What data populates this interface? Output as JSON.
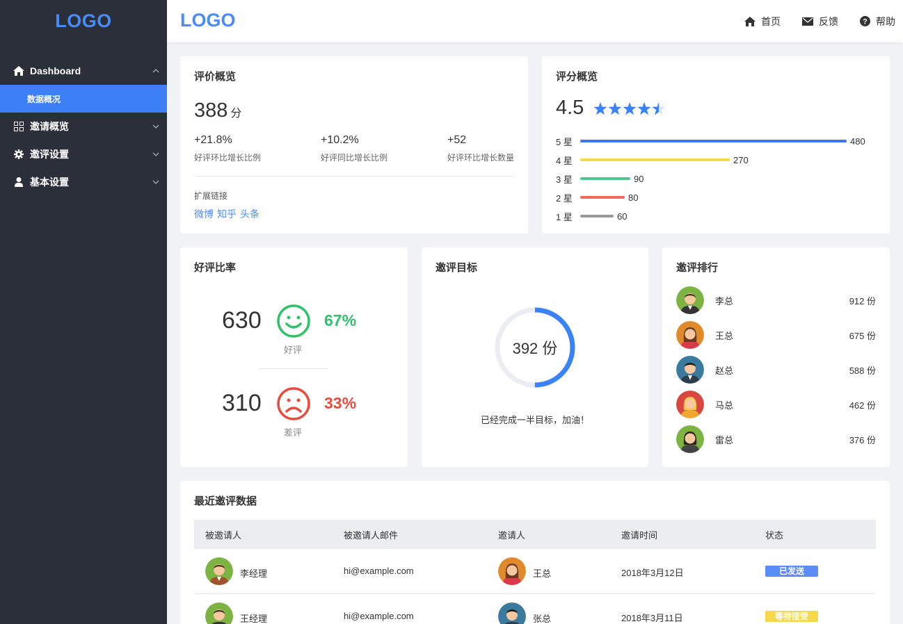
{
  "sidebar": {
    "logo": "LOGO",
    "menu": [
      {
        "label": "Dashboard",
        "icon": "home-icon",
        "expanded": true
      },
      {
        "label": "邀请概览",
        "icon": "grid-icon"
      },
      {
        "label": "邀评设置",
        "icon": "gear-icon"
      },
      {
        "label": "基本设置",
        "icon": "user-icon"
      }
    ],
    "active_sub": "数据概况"
  },
  "header": {
    "logo": "LOGO",
    "nav": [
      {
        "label": "首页",
        "icon": "home-icon"
      },
      {
        "label": "反馈",
        "icon": "mail-icon"
      },
      {
        "label": "帮助",
        "icon": "help-icon"
      }
    ]
  },
  "review_overview": {
    "title": "评价概览",
    "score": "388",
    "score_unit": "分",
    "stats": [
      {
        "value": "+21.8%",
        "label": "好评环比增长比例"
      },
      {
        "value": "+10.2%",
        "label": "好评同比增长比例"
      },
      {
        "value": "+52",
        "label": "好评环比增长数量"
      }
    ],
    "ext_label": "扩展链接",
    "ext_links": [
      "微博",
      "知乎",
      "头条"
    ]
  },
  "rating_overview": {
    "title": "评分概览",
    "rating": "4.5",
    "stars": 4.5,
    "bars": [
      {
        "label": "5 星",
        "value": "480",
        "color": "#3a78f2"
      },
      {
        "label": "4 星",
        "value": "270",
        "color": "#f6d84a"
      },
      {
        "label": "3 星",
        "value": "90",
        "color": "#4fc68f"
      },
      {
        "label": "2 星",
        "value": "80",
        "color": "#ef6a5d"
      },
      {
        "label": "1 星",
        "value": "60",
        "color": "#999999"
      }
    ]
  },
  "good_ratio": {
    "title": "好评比率",
    "good": {
      "count": "630",
      "pct": "67%",
      "label": "好评",
      "color": "#2ec26a"
    },
    "bad": {
      "count": "310",
      "pct": "33%",
      "label": "差评",
      "color": "#e74c3c"
    }
  },
  "goal": {
    "title": "邀评目标",
    "value": "392 份",
    "progress": 0.5,
    "text": "已经完成一半目标，加油！",
    "color": "#3a82f7"
  },
  "ranking": {
    "title": "邀评排行",
    "items": [
      {
        "name": "李总",
        "value": "912 份"
      },
      {
        "name": "王总",
        "value": "675 份"
      },
      {
        "name": "赵总",
        "value": "588 份"
      },
      {
        "name": "马总",
        "value": "462 份"
      },
      {
        "name": "雷总",
        "value": "376 份"
      }
    ]
  },
  "recent": {
    "title": "最近邀评数据",
    "columns": [
      "被邀请人",
      "被邀请人邮件",
      "邀请人",
      "邀请时间",
      "状态"
    ],
    "rows": [
      {
        "invitee": "李经理",
        "email": "hi@example.com",
        "inviter": "王总",
        "time": "2018年3月12日",
        "status": "已发送",
        "status_color": "#5b8cf5"
      },
      {
        "invitee": "王经理",
        "email": "hi@example.com",
        "inviter": "张总",
        "time": "2018年3月11日",
        "status": "等待接受",
        "status_color": "#f6d84a"
      }
    ]
  }
}
